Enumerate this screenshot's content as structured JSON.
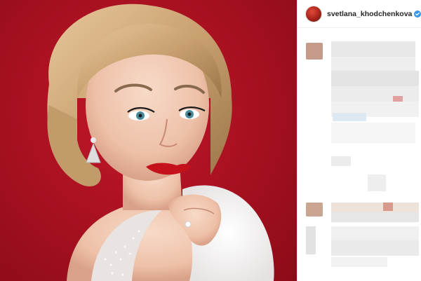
{
  "post": {
    "username": "svetlana_khodchenkova",
    "verified": true,
    "avatar_icon": "profile-avatar",
    "photo_alt": "Portrait photo"
  },
  "colors": {
    "photo_background": "#a5101f",
    "verified_badge": "#3897f0"
  }
}
